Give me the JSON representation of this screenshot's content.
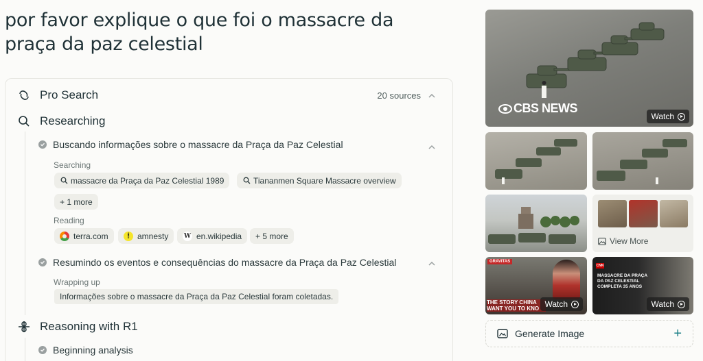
{
  "query": "por favor explique o que foi o massacre da praça da paz celestial",
  "pro_search": {
    "title": "Pro Search",
    "sources_label": "20 sources",
    "researching_label": "Researching",
    "steps": [
      {
        "title": "Buscando informações sobre o massacre da Praça da Paz Celestial",
        "searching_label": "Searching",
        "queries": [
          "massacre da Praça da Paz Celestial 1989",
          "Tiananmen Square Massacre overview"
        ],
        "more_queries": "+ 1 more",
        "reading_label": "Reading",
        "sources": [
          "terra.com",
          "amnesty",
          "en.wikipedia"
        ],
        "more_sources": "+ 5 more"
      },
      {
        "title": "Resumindo os eventos e consequências do massacre da Praça da Paz Celestial",
        "wrapping_label": "Wrapping up",
        "result": "Informações sobre o massacre da Praça da Paz Celestial foram coletadas."
      }
    ],
    "reasoning_label": "Reasoning with R1",
    "reasoning_step": "Beginning analysis"
  },
  "media": {
    "hero_brand": "CBS NEWS",
    "watch_label": "Watch",
    "view_more_label": "View More",
    "video1_caption": "THE STORY CHINA WANT YOU TO KNO",
    "video1_badge": "GRAVITAS",
    "video2_caption": "MASSACRE DA PRAÇA DA PAZ CELESTIAL COMPLETA 35 ANOS",
    "video2_badge": "CNN",
    "generate_image_label": "Generate Image"
  }
}
